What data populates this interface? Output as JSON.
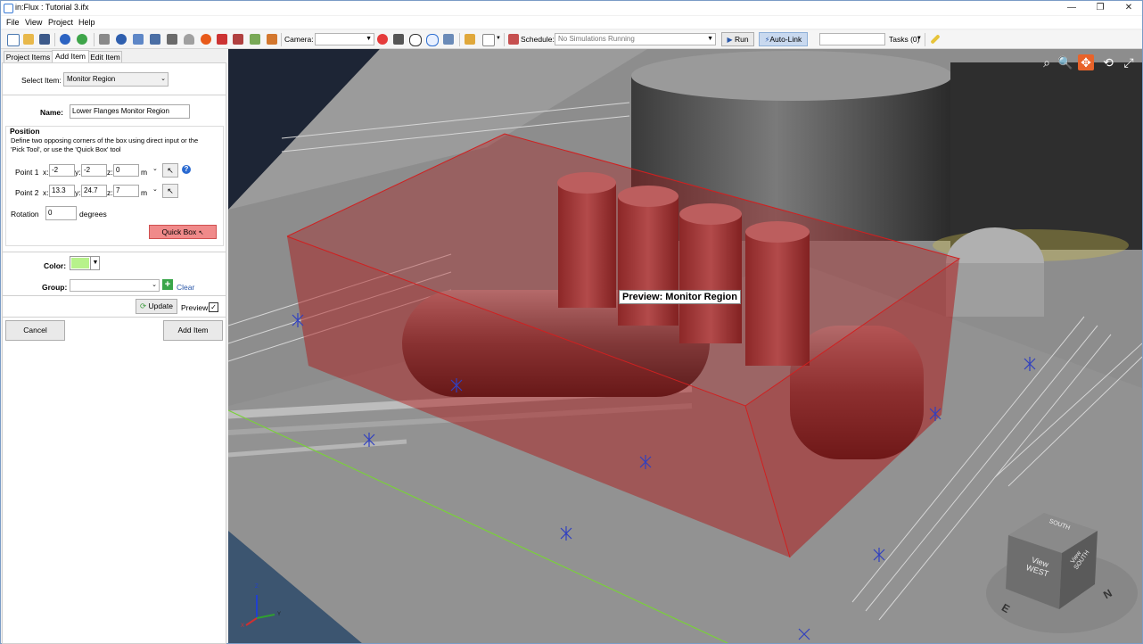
{
  "window": {
    "title": "in:Flux : Tutorial 3.ifx",
    "minimize": "—",
    "maximize": "❐",
    "close": "✕"
  },
  "menu": [
    "File",
    "View",
    "Project",
    "Help"
  ],
  "toolbar": {
    "camera_label": "Camera:",
    "camera_value": "",
    "schedule_label": "Schedule:",
    "schedule_value": "No Simulations Running",
    "run_label": "Run",
    "autolink_label": "Auto-Link",
    "tasks_label": "Tasks (0)"
  },
  "tabs": [
    "Project Items",
    "Add Item",
    "Edit Item"
  ],
  "form": {
    "select_item_label": "Select Item:",
    "select_item_value": "Monitor Region",
    "name_label": "Name:",
    "name_value": "Lower Flanges Monitor Region",
    "position_heading": "Position",
    "position_desc": "Define two opposing corners of the box using direct input or the 'Pick Tool', or use the 'Quick Box' tool",
    "point1_label": "Point 1",
    "point2_label": "Point 2",
    "x_label": "x:",
    "y_label": "y:",
    "z_label": "z:",
    "unit_m": "m",
    "point1": {
      "x": "-2",
      "y": "-2",
      "z": "0"
    },
    "point2": {
      "x": "13.3",
      "y": "24.7",
      "z": "7"
    },
    "rotation_label": "Rotation",
    "rotation_value": "0",
    "rotation_unit": "degrees",
    "quickbox_label": "Quick Box",
    "color_label": "Color:",
    "color_value": "#b7f28b",
    "group_label": "Group:",
    "group_value": "",
    "clear_label": "Clear",
    "update_label": "Update",
    "preview_label": "Preview",
    "preview_checked": "✓",
    "cancel_label": "Cancel",
    "add_item_label": "Add Item"
  },
  "viewport": {
    "preview_label": "Preview: Monitor Region",
    "viewcube": {
      "top": "SOUTH",
      "front": "View WEST",
      "side": "View SOUTH"
    },
    "compass": [
      "N",
      "E"
    ],
    "axes": {
      "z": "Z",
      "x": "X",
      "y": "Y"
    }
  },
  "colors": {
    "region_fill": "#b01010",
    "quickbox_bg": "#f08a8a",
    "autolink_bg": "#c9d9ef",
    "ground": "#8d8d8d",
    "water": "#3c5570"
  }
}
